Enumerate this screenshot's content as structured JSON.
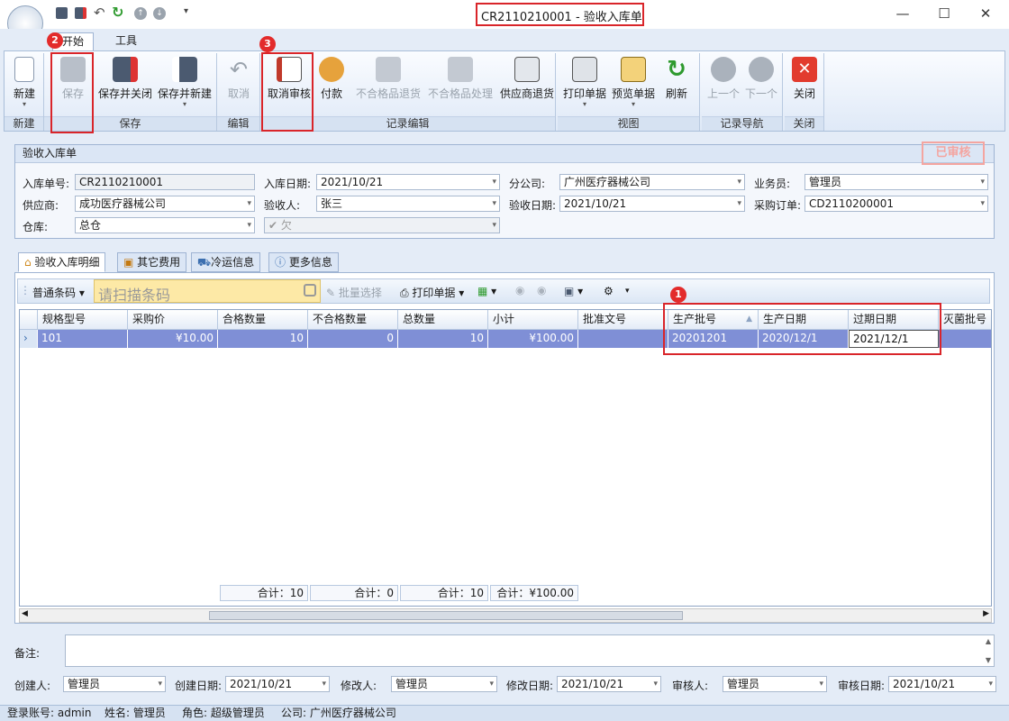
{
  "window": {
    "title": "CR2110210001 - 验收入库单"
  },
  "ribbon_tabs": [
    {
      "label": "开始"
    },
    {
      "label": "工具"
    }
  ],
  "ribbon": {
    "new": "新建",
    "save": "保存",
    "save_close": "保存并关闭",
    "save_new": "保存并新建",
    "cancel": "取消",
    "unaudit": "取消审核",
    "pay": "付款",
    "reject_return": "不合格品退货",
    "reject_handle": "不合格品处理",
    "supplier_return": "供应商退货",
    "print": "打印单据",
    "preview": "预览单据",
    "refresh": "刷新",
    "prev": "上一个",
    "next": "下一个",
    "close": "关闭",
    "groups": {
      "new": "新建",
      "save": "保存",
      "edit": "编辑",
      "record_edit": "记录编辑",
      "view": "视图",
      "nav": "记录导航",
      "close": "关闭"
    }
  },
  "form": {
    "title": "验收入库单",
    "status_stamp": "已审核",
    "order_no_label": "入库单号:",
    "order_no": "CR2110210001",
    "in_date_label": "入库日期:",
    "in_date": "2021/10/21",
    "branch_label": "分公司:",
    "branch": "广州医疗器械公司",
    "sales_label": "业务员:",
    "sales": "管理员",
    "supplier_label": "供应商:",
    "supplier": "成功医疗器械公司",
    "receiver_label": "验收人:",
    "receiver": "张三",
    "check_date_label": "验收日期:",
    "check_date": "2021/10/21",
    "po_label": "采购订单:",
    "po": "CD2110200001",
    "warehouse_label": "仓库:",
    "warehouse": "总仓",
    "owe": "欠"
  },
  "detail_tabs": [
    {
      "label": "验收入库明细"
    },
    {
      "label": "其它费用"
    },
    {
      "label": "冷运信息"
    },
    {
      "label": "更多信息"
    }
  ],
  "grid_toolbar": {
    "barcode_mode": "普通条码",
    "scan_placeholder": "请扫描条码",
    "batch_select": "批量选择",
    "print": "打印单据"
  },
  "grid": {
    "columns": [
      "规格型号",
      "采购价",
      "合格数量",
      "不合格数量",
      "总数量",
      "小计",
      "批准文号",
      "生产批号",
      "生产日期",
      "过期日期",
      "灭菌批号"
    ],
    "rows": [
      [
        "101",
        "¥10.00",
        "10",
        "0",
        "10",
        "¥100.00",
        "",
        "20201201",
        "2020/12/1",
        "2021/12/1",
        ""
      ]
    ],
    "footer": [
      "合计：10",
      "合计：0",
      "合计：10",
      "合计：¥100.00"
    ]
  },
  "bottom": {
    "remark_label": "备注:",
    "creator_label": "创建人:",
    "creator": "管理员",
    "create_date_label": "创建日期:",
    "create_date": "2021/10/21",
    "modifier_label": "修改人:",
    "modifier": "管理员",
    "modify_date_label": "修改日期:",
    "modify_date": "2021/10/21",
    "auditor_label": "审核人:",
    "auditor": "管理员",
    "audit_date_label": "审核日期:",
    "audit_date": "2021/10/21"
  },
  "status_bar": {
    "account": "登录账号: admin",
    "name": "姓名: 管理员",
    "role": "角色: 超级管理员",
    "company": "公司: 广州医疗器械公司"
  },
  "annotations": [
    "1",
    "2",
    "3"
  ]
}
